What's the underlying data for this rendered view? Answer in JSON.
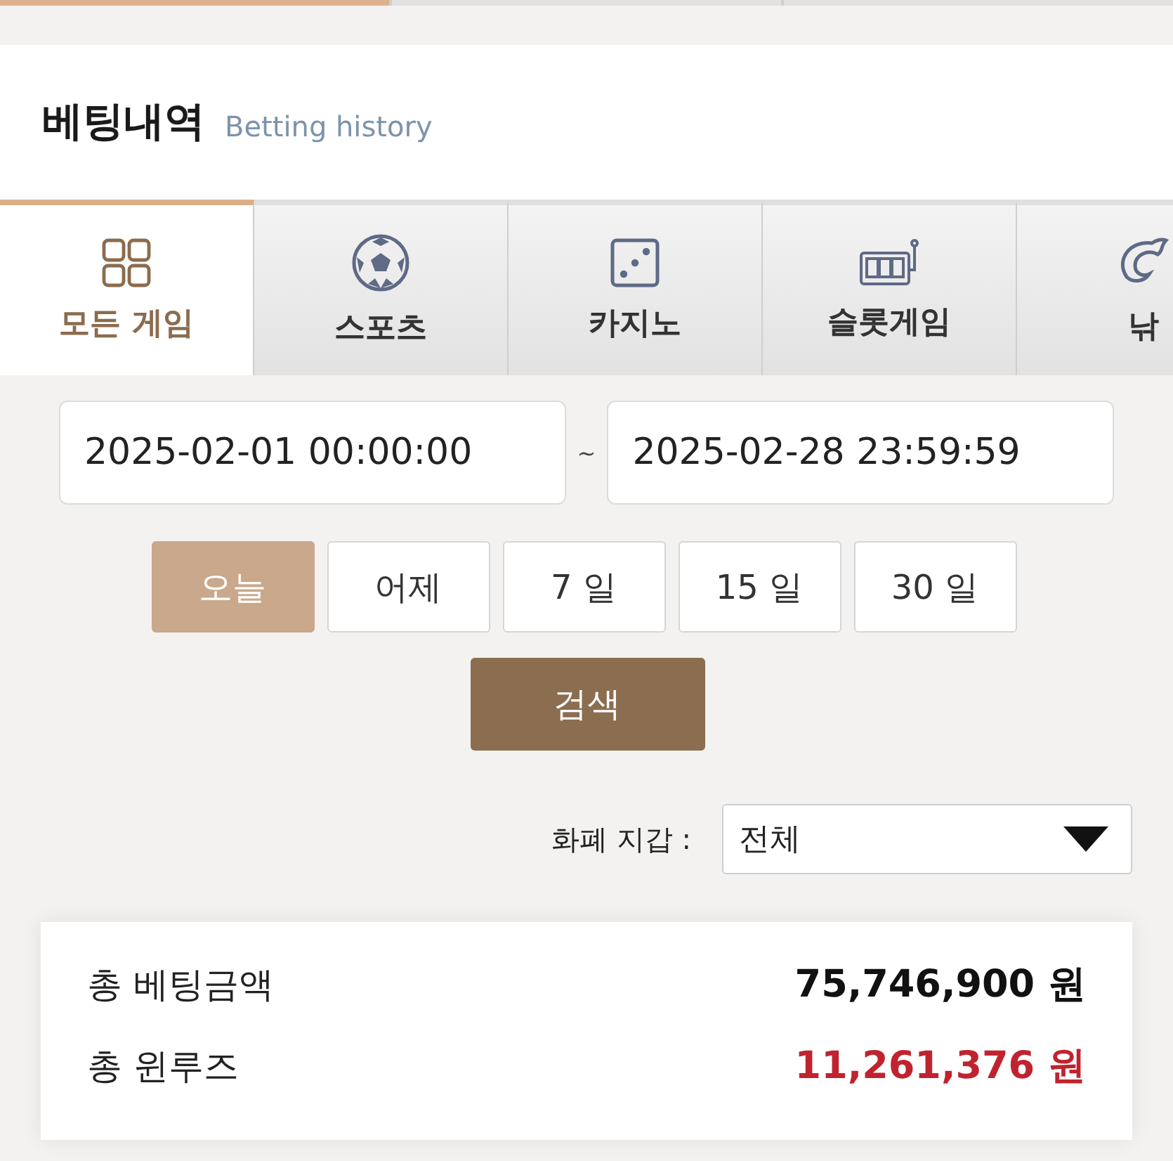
{
  "header": {
    "title": "베팅내역",
    "subtitle": "Betting history"
  },
  "tabs": [
    {
      "label": "모든 게임",
      "kind": "grid",
      "selected": true
    },
    {
      "label": "스포츠",
      "kind": "ball",
      "selected": false
    },
    {
      "label": "카지노",
      "kind": "dice",
      "selected": false
    },
    {
      "label": "슬롯게임",
      "kind": "slot",
      "selected": false
    },
    {
      "label": "낚",
      "kind": "fish",
      "selected": false
    }
  ],
  "date_range": {
    "start": "2025-02-01 00:00:00",
    "separator": "~",
    "end": "2025-02-28 23:59:59"
  },
  "quick_ranges": [
    {
      "label": "오늘",
      "selected": true
    },
    {
      "label": "어제",
      "selected": false
    },
    {
      "label": "7 일",
      "selected": false
    },
    {
      "label": "15 일",
      "selected": false
    },
    {
      "label": "30 일",
      "selected": false
    }
  ],
  "search_button": "검색",
  "currency_filter": {
    "label": "화폐 지갑 :",
    "value": "전체"
  },
  "summary": [
    {
      "label": "총 베팅금액",
      "amount": "75,746,900 원",
      "color": "#111111"
    },
    {
      "label": "총 윈루즈",
      "amount": "11,261,376 원",
      "color": "#c0232f"
    }
  ]
}
